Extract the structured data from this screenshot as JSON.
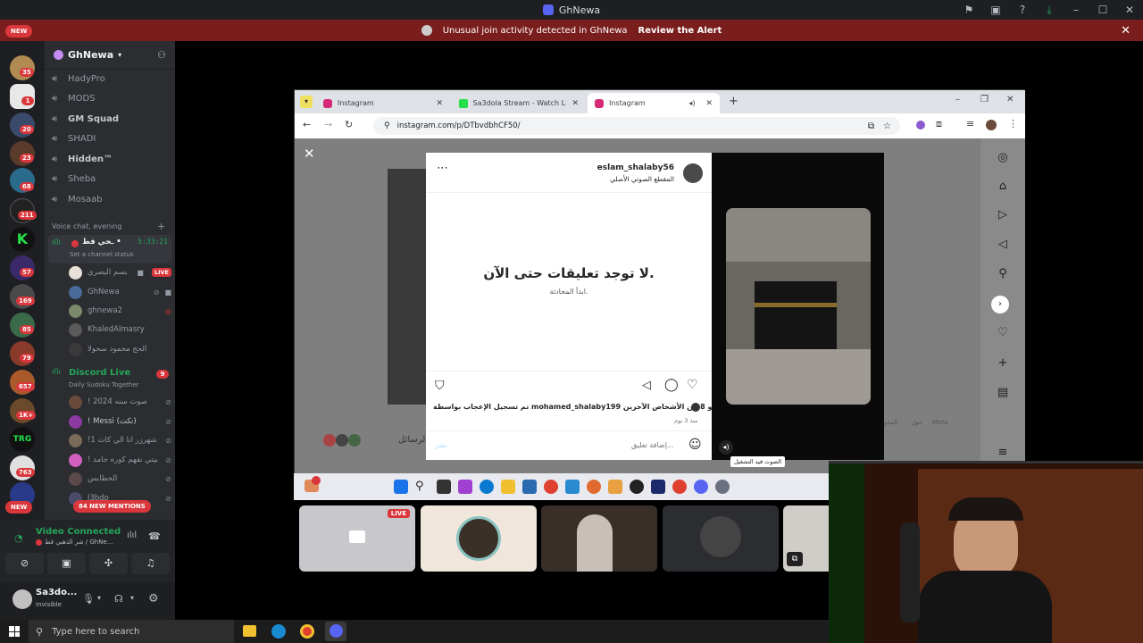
{
  "window": {
    "title": "GhNewa",
    "controls": [
      "minimize",
      "maximize",
      "close"
    ]
  },
  "alert": {
    "text": "Unusual join activity detected in GhNewa",
    "action": "Review the Alert"
  },
  "rail": {
    "new_top": "NEW",
    "new_bottom": "NEW",
    "badges": [
      "35",
      "1",
      "20",
      "23",
      "68",
      "211",
      "57",
      "169",
      "85",
      "79",
      "657",
      "1K+",
      "763"
    ]
  },
  "server": {
    "name": "GhNewa",
    "channels": [
      "HadyPro",
      "MODS",
      "GM Squad",
      "SHADI",
      "Hidden™",
      "Sheba",
      "Mosaab"
    ]
  },
  "voice": {
    "category": "Voice chat, evening",
    "channel_name": "ـحي قط •",
    "timer": "5:33:21",
    "status": "Set a channel status",
    "members": [
      {
        "name": "بسم البصري",
        "live": "LIVE"
      },
      {
        "name": "GhNewa"
      },
      {
        "name": "ghnewa2"
      },
      {
        "name": "KhaledAlmasry"
      },
      {
        "name": "الحج محمود سحولا"
      }
    ]
  },
  "discord_live": {
    "title": "Discord Live",
    "badge": "9",
    "subtitle": "Daily Sudoku Together",
    "members": [
      "! 2024 صوت سنه",
      "! Messi (تكت)",
      "!1 شهرزر انا الي كات",
      "! بيتي نفهم كوره جامد",
      "الحطابس",
      "l3bdo"
    ],
    "mentions": "84 NEW MENTIONS"
  },
  "connection": {
    "status": "Video Connected",
    "detail": "شر الذهبي قط / GhNe..."
  },
  "user": {
    "name": "Sa3do...",
    "presence": "Invisible"
  },
  "browser": {
    "tabs": [
      "Instagram",
      "Sa3dola Stream - Watch Live o",
      "Instagram"
    ],
    "url": "instagram.com/p/DTbvdbhCF50/"
  },
  "instagram": {
    "username": "eslam_shalaby56",
    "audio": "المقطع الصوتي الأصلي",
    "no_comments": "لا توجد تعليقات حتى الآن.",
    "start_conv": "ابدأ المحادثة.",
    "likes": "تم تسجيل الإعجاب بواسطة mohamed_shalaby199 و 8 من الأشخاص الآخرين",
    "time": "منذ 3 يوم",
    "comment_placeholder": "إضافة تعليق...",
    "post": "نشر",
    "tooltip": "الصوت قيد التشغيل",
    "bg_labels": [
      "الرسائل",
      "حول",
      "المدو",
      "Meta"
    ]
  },
  "streams": {
    "live_label": "LIVE"
  },
  "taskbar": {
    "search_placeholder": "Type here to search"
  },
  "colors": {
    "discord_bg": "#2b2d31",
    "rail_bg": "#1e1f22",
    "alert_bg": "#7a1d1d",
    "accent_green": "#23a55a",
    "danger": "#da373c"
  }
}
